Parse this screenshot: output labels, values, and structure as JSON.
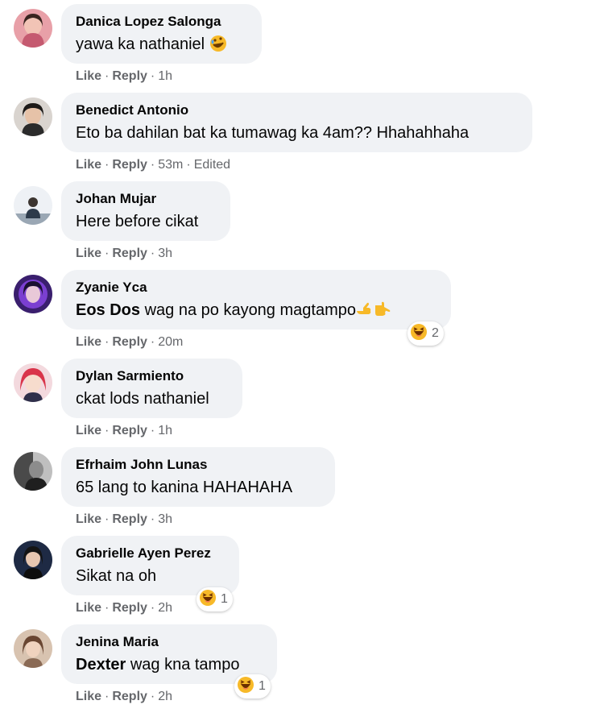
{
  "actions": {
    "like": "Like",
    "reply": "Reply",
    "separator": "·"
  },
  "comments": [
    {
      "author": "Danica Lopez Salonga",
      "text": "yawa ka nathaniel",
      "time": "1h"
    },
    {
      "author": "Benedict Antonio",
      "text": "Eto ba dahilan bat ka tumawag ka 4am?? Hhahahhaha",
      "time": "53m",
      "edited": "Edited"
    },
    {
      "author": "Johan Mujar",
      "text": "Here before cikat",
      "time": "3h"
    },
    {
      "author": "Zyanie Yca",
      "mention": "Eos Dos",
      "text": " wag na po kayong magtampo",
      "time": "20m",
      "reaction_count": "2"
    },
    {
      "author": "Dylan Sarmiento",
      "text": "ckat lods nathaniel",
      "time": "1h"
    },
    {
      "author": "Efrhaim John Lunas",
      "text": "65 lang to kanina HAHAHAHA",
      "time": "3h"
    },
    {
      "author": "Gabrielle Ayen Perez",
      "text": "Sikat na oh",
      "time": "2h",
      "reaction_count": "1"
    },
    {
      "author": "Jenina Maria",
      "mention": "Dexter",
      "text": " wag kna tampo",
      "time": "2h",
      "reaction_count": "1"
    }
  ],
  "icons": {
    "laugh_tears": "rolling-on-floor-laughing-emoji",
    "pointing_hands": "pointing-hands-emoji",
    "haha_reaction": "haha-reaction-icon"
  },
  "colors": {
    "bubble": "#f0f2f5",
    "meta": "#65676b",
    "text": "#050505",
    "haha": "#f7b928"
  }
}
